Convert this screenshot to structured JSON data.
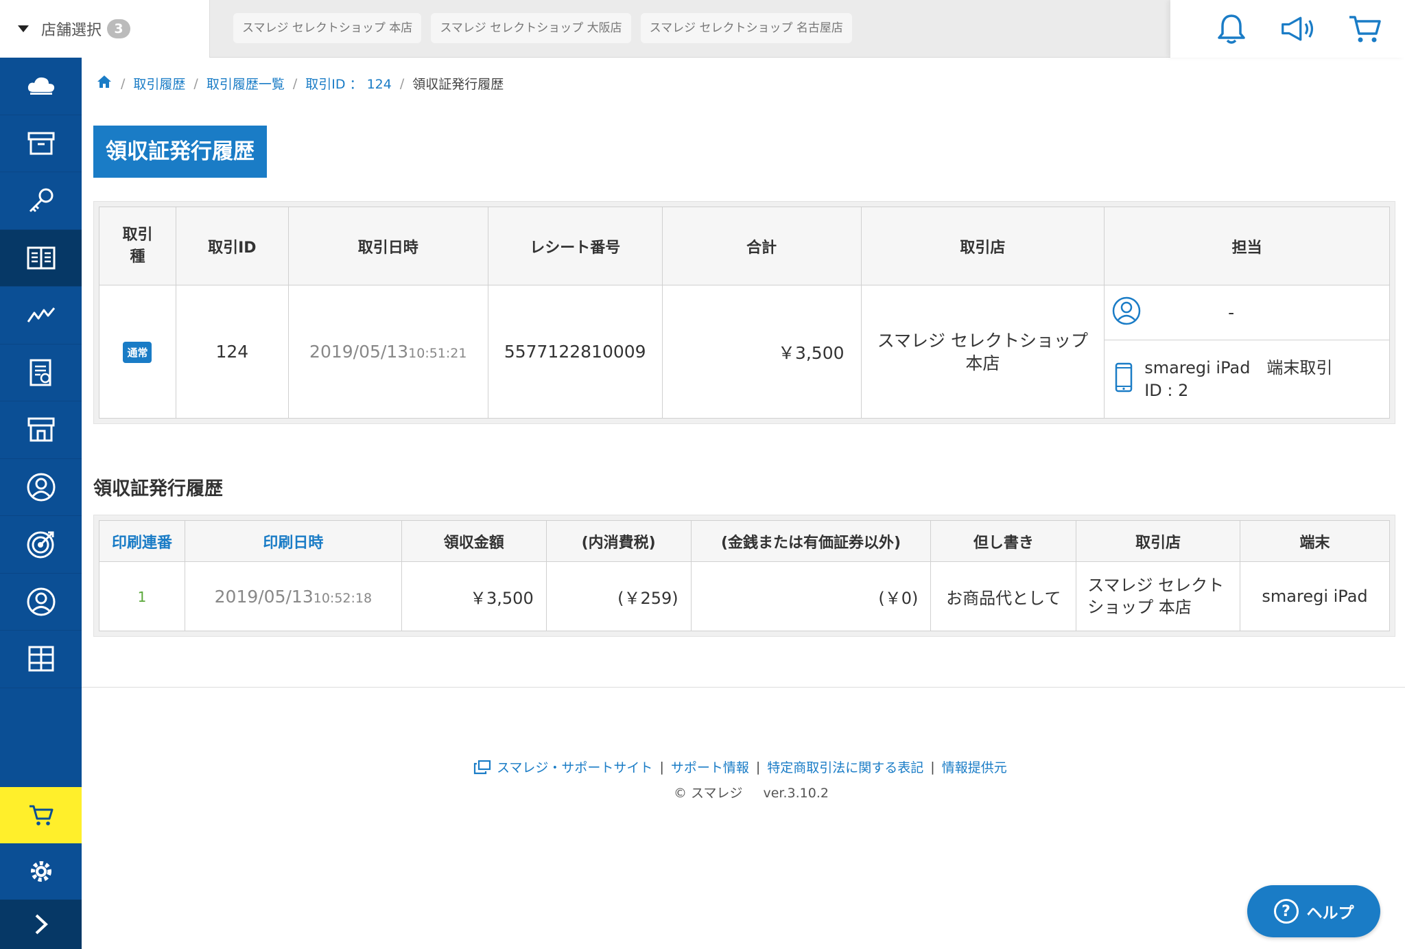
{
  "header": {
    "store_select_label": "店舗選択",
    "store_select_count": "3",
    "store_tabs": [
      "スマレジ セレクトショップ 本店",
      "スマレジ セレクトショップ 大阪店",
      "スマレジ セレクトショップ 名古屋店"
    ],
    "icons": [
      "bell-icon",
      "megaphone-icon",
      "cart-icon"
    ]
  },
  "sidebar": {
    "items": [
      "cloud-icon",
      "archive-box-icon",
      "key-icon",
      "book-icon",
      "chart-line-icon",
      "report-icon",
      "store-icon",
      "user-circle-icon",
      "target-icon",
      "person-circle-icon",
      "grid-icon"
    ],
    "active_index": 3
  },
  "breadcrumb": {
    "items": [
      "取引履歴",
      "取引履歴一覧",
      "取引ID ： 124"
    ],
    "current": "領収証発行履歴"
  },
  "page_title": "領収証発行履歴",
  "transaction": {
    "headers": [
      "取引\n種",
      "取引ID",
      "取引日時",
      "レシート番号",
      "合計",
      "取引店",
      "担当"
    ],
    "type_badge": "通常",
    "id": "124",
    "date": "2019/05/13",
    "time": "10:51:21",
    "receipt_no": "5577122810009",
    "total": "￥3,500",
    "store": "スマレジ セレクトショップ\n本店",
    "staff": "-",
    "terminal_line1": "smaregi iPad　端末取引",
    "terminal_line2": "ID : 2"
  },
  "receipt_section_title": "領収証発行履歴",
  "receipts": {
    "headers": [
      "印刷連番",
      "印刷日時",
      "領収金額",
      "(内消費税)",
      "(金銭または有価証券以外)",
      "但し書き",
      "取引店",
      "端末"
    ],
    "rows": [
      {
        "seq": "1",
        "date": "2019/05/13",
        "time": "10:52:18",
        "amount": "￥3,500",
        "tax": "(￥259)",
        "non_cash": "(￥0)",
        "memo": "お商品代として",
        "store": "スマレジ セレクト\nショップ 本店",
        "terminal": "smaregi iPad"
      }
    ]
  },
  "footer": {
    "links": [
      "スマレジ・サポートサイト",
      "サポート情報",
      "特定商取引法に関する表記",
      "情報提供元"
    ],
    "copyright": "© スマレジ",
    "version": "ver.3.10.2"
  },
  "help_button": "ヘルプ",
  "colors": {
    "brand_blue": "#1a7cc6",
    "sidebar_blue": "#0b4f95",
    "cart_yellow": "#ffef2b"
  }
}
